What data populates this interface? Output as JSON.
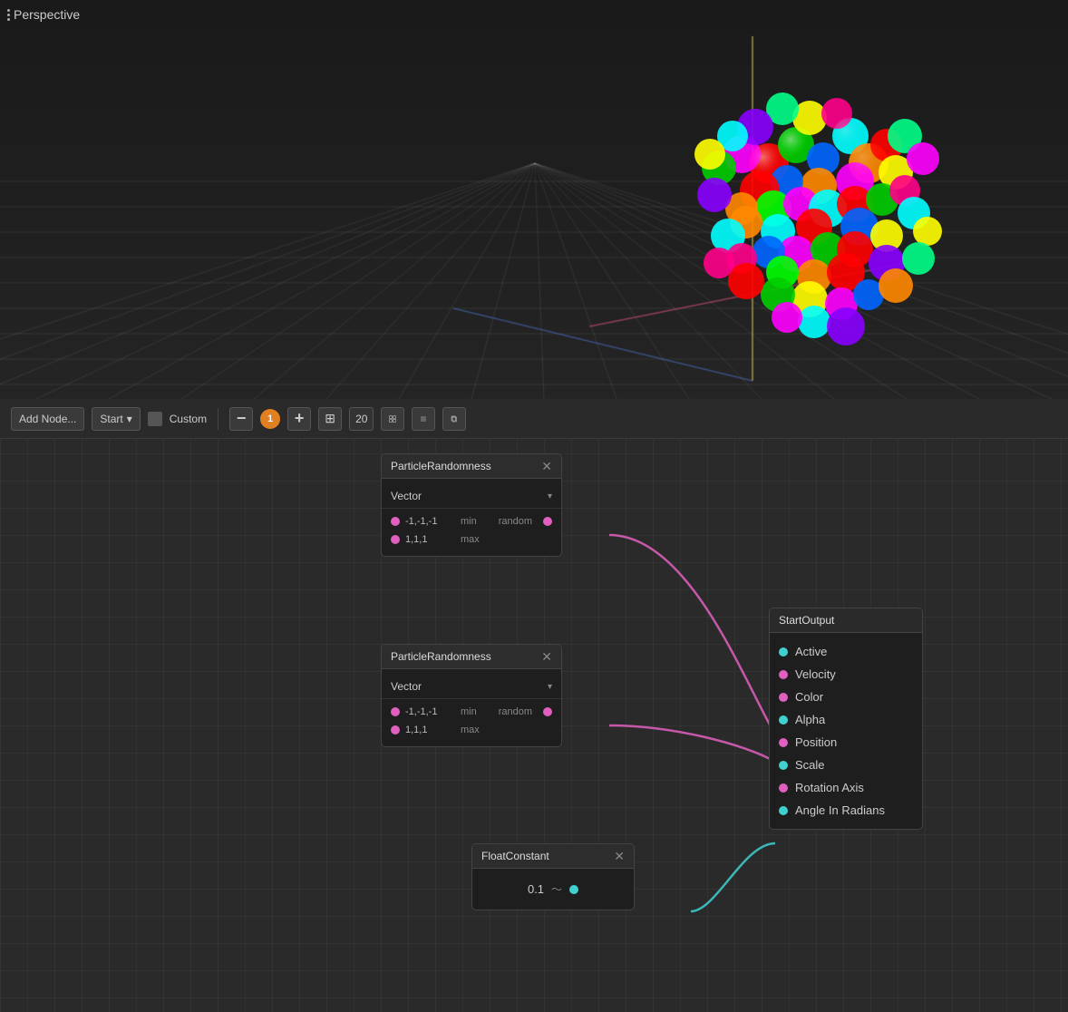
{
  "viewport": {
    "label": "Perspective",
    "grid_color": "rgba(255,255,255,0.15)"
  },
  "toolbar": {
    "add_node_label": "Add Node...",
    "start_label": "Start",
    "custom_label": "Custom",
    "zoom_value": "20",
    "minus_label": "−",
    "plus_label": "+",
    "arrow_up_down": "⇅"
  },
  "nodes": {
    "particle_randomness_1": {
      "title": "ParticleRandomness",
      "type_label": "Vector",
      "min_value": "-1,-1,-1",
      "min_label": "min",
      "random_label": "random",
      "max_value": "1,1,1",
      "max_label": "max"
    },
    "particle_randomness_2": {
      "title": "ParticleRandomness",
      "type_label": "Vector",
      "min_value": "-1,-1,-1",
      "min_label": "min",
      "random_label": "random",
      "max_value": "1,1,1",
      "max_label": "max"
    },
    "float_constant": {
      "title": "FloatConstant",
      "value": "0.1"
    },
    "start_output": {
      "title": "StartOutput",
      "outputs": [
        {
          "label": "Active",
          "color": "cyan"
        },
        {
          "label": "Velocity",
          "color": "pink"
        },
        {
          "label": "Color",
          "color": "pink"
        },
        {
          "label": "Alpha",
          "color": "cyan"
        },
        {
          "label": "Position",
          "color": "pink"
        },
        {
          "label": "Scale",
          "color": "cyan"
        },
        {
          "label": "Rotation Axis",
          "color": "pink"
        },
        {
          "label": "Angle In Radians",
          "color": "cyan"
        }
      ]
    }
  },
  "colors": {
    "accent_pink": "#e060c0",
    "accent_cyan": "#40d0d0",
    "node_bg": "#1e1e1e",
    "toolbar_bg": "#2a2a2a",
    "editor_bg": "#2a2a2a"
  }
}
